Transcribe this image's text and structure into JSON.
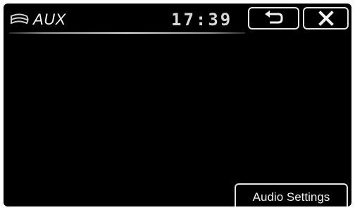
{
  "header": {
    "source_icon": "aux-source-icon",
    "source_label": "AUX",
    "clock": "17:39",
    "back_icon": "back-arrow-icon",
    "close_icon": "close-x-icon"
  },
  "footer": {
    "audio_settings_label": "Audio Settings"
  },
  "colors": {
    "background": "#000000",
    "foreground": "#f2f2f2",
    "button_border": "#e6e6e6",
    "bezel": "#ffffff"
  }
}
